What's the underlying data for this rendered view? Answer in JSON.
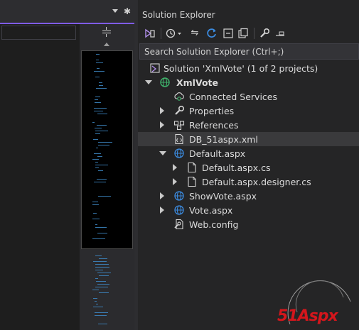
{
  "solution_explorer": {
    "title": "Solution Explorer",
    "search_placeholder": "Search Solution Explorer (Ctrl+;)",
    "toolbar": [
      {
        "name": "vs-switch-views-icon"
      },
      {
        "name": "history-icon"
      },
      {
        "name": "sync-arrows-icon"
      },
      {
        "name": "refresh-icon"
      },
      {
        "name": "collapse-all-icon"
      },
      {
        "name": "show-all-files-icon"
      },
      {
        "name": "properties-wrench-icon"
      },
      {
        "name": "preview-icon"
      }
    ],
    "tree": {
      "solution": "Solution 'XmlVote' (1 of 2 projects)",
      "project": "XmlVote",
      "items": {
        "connected_services": "Connected Services",
        "properties": "Properties",
        "references": "References",
        "db_xml": "DB_51aspx.xml",
        "default_aspx": "Default.aspx",
        "default_cs": "Default.aspx.cs",
        "default_designer": "Default.aspx.designer.cs",
        "showvote": "ShowVote.aspx",
        "vote": "Vote.aspx",
        "webconfig": "Web.config"
      }
    }
  },
  "watermark": {
    "text": "51Aspx"
  },
  "colors": {
    "accent": "#7f5ce6",
    "project_icon": "#3fb36b",
    "globe_icon": "#3b8be0",
    "watermark": "#d4161c"
  }
}
